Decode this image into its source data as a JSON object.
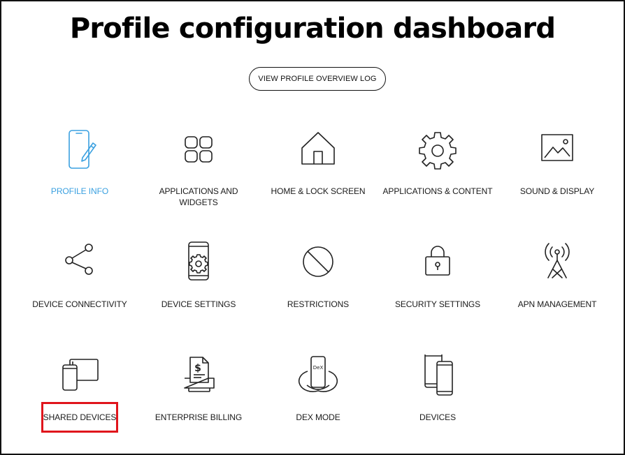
{
  "page": {
    "title": "Profile configuration dashboard",
    "log_button_label": "VIEW PROFILE OVERVIEW LOG"
  },
  "colors": {
    "active": "#3aa0e0",
    "highlight": "#e0151c",
    "text": "#1a1a1a"
  },
  "tiles": [
    {
      "label": "PROFILE INFO",
      "icon": "phone-pen-icon",
      "active": true
    },
    {
      "label": "APPLICATIONS AND WIDGETS",
      "icon": "widgets-grid-icon"
    },
    {
      "label": "HOME & LOCK SCREEN",
      "icon": "home-icon"
    },
    {
      "label": "APPLICATIONS & CONTENT",
      "icon": "gear-icon"
    },
    {
      "label": "SOUND & DISPLAY",
      "icon": "picture-icon"
    },
    {
      "label": "DEVICE CONNECTIVITY",
      "icon": "share-icon"
    },
    {
      "label": "DEVICE SETTINGS",
      "icon": "phone-gear-icon"
    },
    {
      "label": "RESTRICTIONS",
      "icon": "prohibited-icon"
    },
    {
      "label": "SECURITY SETTINGS",
      "icon": "lock-icon"
    },
    {
      "label": "APN MANAGEMENT",
      "icon": "antenna-icon"
    },
    {
      "label": "SHARED DEVICES",
      "icon": "tablet-phone-icon",
      "highlighted": true
    },
    {
      "label": "ENTERPRISE BILLING",
      "icon": "billing-icon"
    },
    {
      "label": "DEX MODE",
      "icon": "dex-icon"
    },
    {
      "label": "DEVICES",
      "icon": "devices-icon"
    }
  ]
}
